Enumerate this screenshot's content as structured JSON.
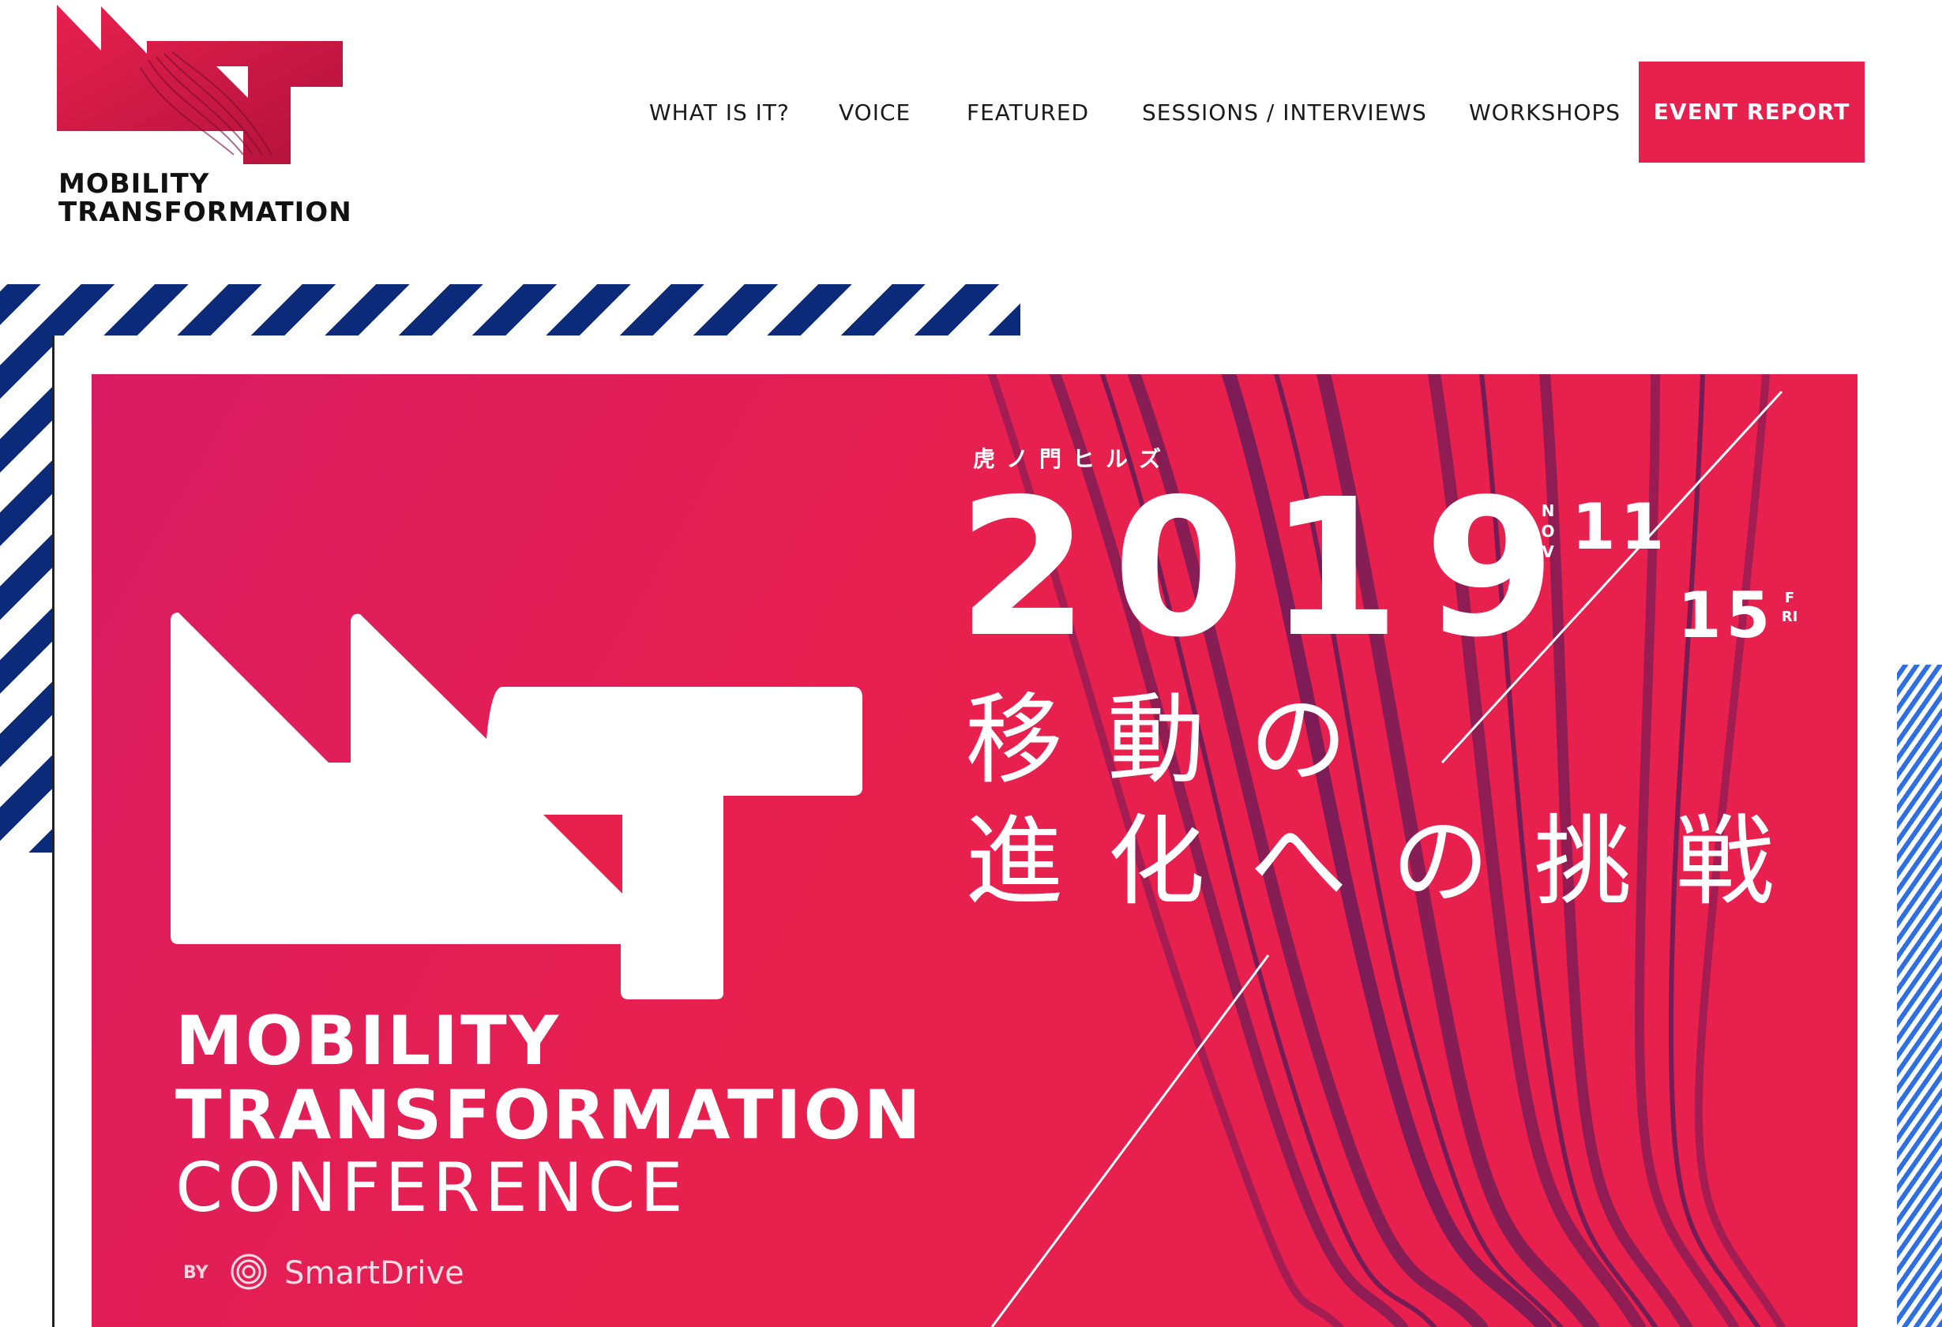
{
  "header": {
    "logo": {
      "line1": "MOBILITY",
      "line2": "TRANSFORMATION",
      "icon": "mt-logo-icon"
    },
    "nav": [
      {
        "label": "WHAT IS IT?"
      },
      {
        "label": "VOICE"
      },
      {
        "label": "FEATURED"
      },
      {
        "label": "SESSIONS / INTERVIEWS"
      },
      {
        "label": "WORKSHOPS"
      }
    ],
    "cta_label": "EVENT REPORT"
  },
  "hero": {
    "venue": "虎ノ門ヒルズ",
    "year": "2019",
    "month": "NOV",
    "day_start": "11",
    "day_end": "15",
    "weekday": "FRI",
    "tagline_line1": "移動の",
    "tagline_line2": "進化への挑戦",
    "conference": {
      "line1": "MOBILITY",
      "line2": "TRANSFORMATION",
      "line3": "CONFERENCE"
    },
    "by_label": "BY",
    "sponsor": "SmartDrive"
  },
  "colors": {
    "brand_red": "#e8204e",
    "brand_magenta": "#d91c62",
    "navy": "#0b2a7a",
    "blue": "#3d7ee8",
    "white": "#ffffff"
  }
}
